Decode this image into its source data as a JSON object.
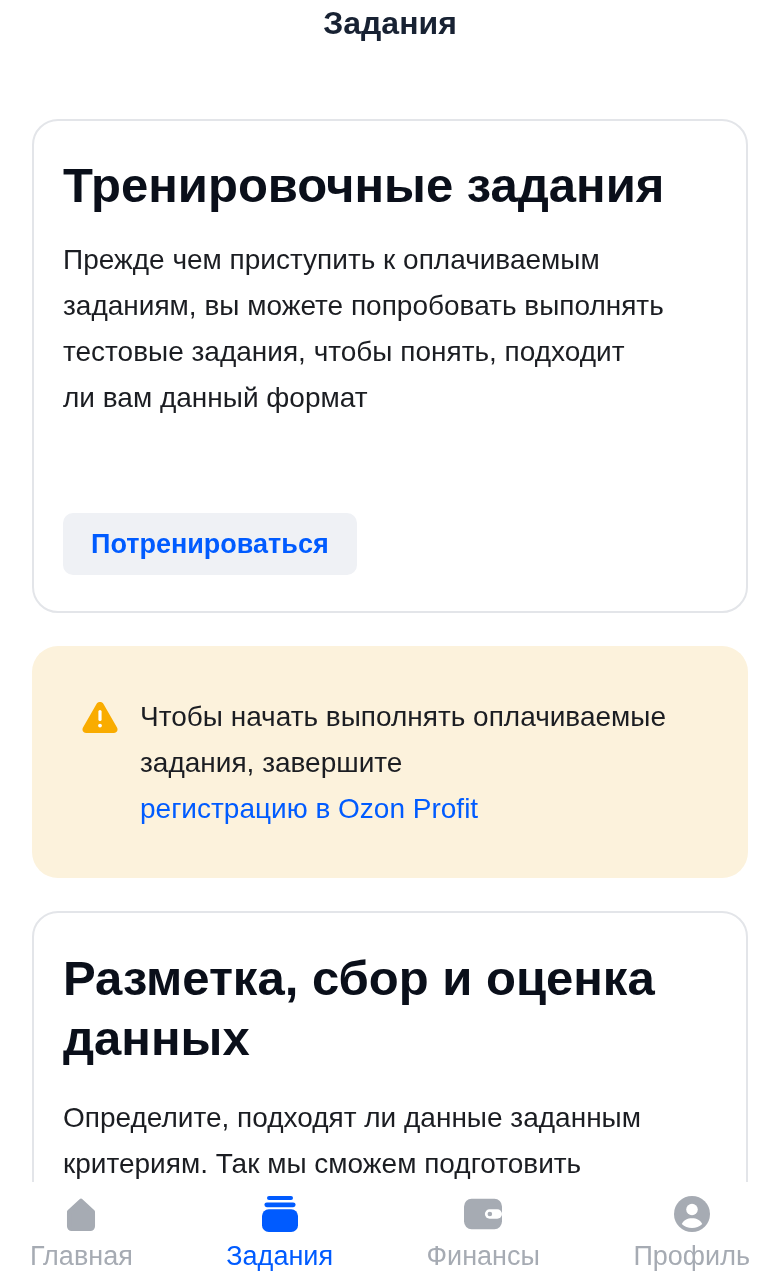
{
  "header": {
    "title": "Задания"
  },
  "training_card": {
    "title": "Тренировочные задания",
    "description": "Прежде чем приступить к оплачиваемым заданиям, вы можете попробовать выполнять тестовые задания, чтобы понять, подходит ли вам данный формат",
    "button": "Потренироваться"
  },
  "notice": {
    "text": "Чтобы начать выполнять оплачиваемые задания, завершите",
    "link": "регистрацию в Ozon Profit"
  },
  "data_card": {
    "title": "Разметка, сбор и оценка данных",
    "description": "Определите, подходят ли данные заданным критериям. Так мы сможем подготовить"
  },
  "tab_bar": [
    {
      "label": "Главная",
      "selected": false
    },
    {
      "label": "Задания",
      "selected": true
    },
    {
      "label": "Финансы",
      "selected": false
    },
    {
      "label": "Профиль",
      "selected": false
    }
  ]
}
